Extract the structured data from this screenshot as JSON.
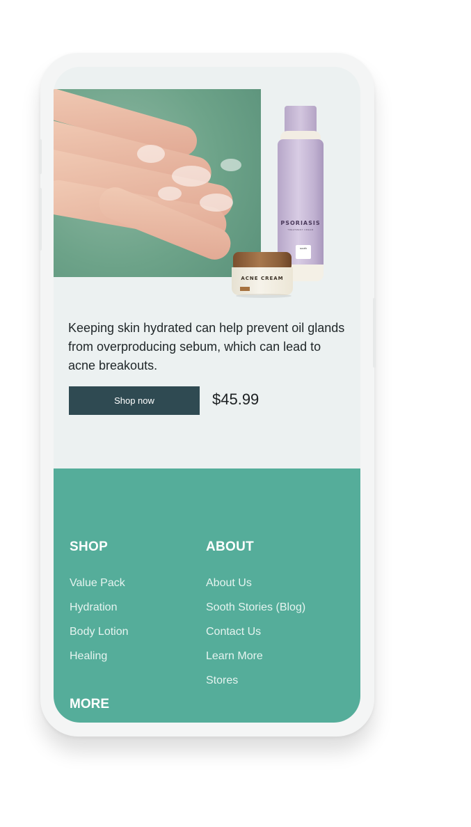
{
  "product": {
    "description": "Keeping skin hydrated can help prevent oil glands from overproducing sebum, which can lead to acne breakouts.",
    "cta_label": "Shop now",
    "price": "$45.99",
    "image": {
      "bottle_label": "PSORIASIS",
      "bottle_sublabel": "TREATMENT CREAM",
      "bottle_sticker": "sooth",
      "jar_label": "ACNE CREAM"
    }
  },
  "footer": {
    "shop": {
      "heading": "SHOP",
      "links": [
        "Value Pack",
        "Hydration",
        "Body Lotion",
        "Healing"
      ]
    },
    "about": {
      "heading": "ABOUT",
      "links": [
        "About Us",
        "Sooth Stories (Blog)",
        "Contact Us",
        "Learn More",
        "Stores"
      ]
    },
    "more": {
      "heading": "MORE"
    }
  },
  "colors": {
    "footer_bg": "#55ad9a",
    "button_bg": "#2f4a52",
    "screen_bg": "#ecf1f1"
  }
}
